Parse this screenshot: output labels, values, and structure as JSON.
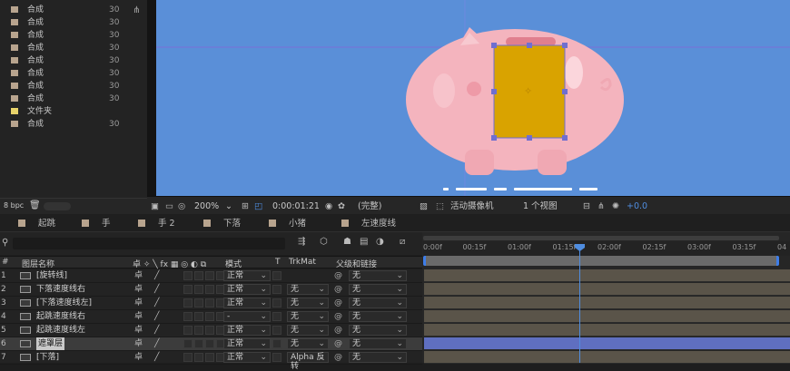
{
  "project": {
    "rows": [
      {
        "name": "合成",
        "duration": "30",
        "color": "#b8a48e"
      },
      {
        "name": "合成",
        "duration": "30",
        "color": "#b8a48e"
      },
      {
        "name": "合成",
        "duration": "30",
        "color": "#b8a48e"
      },
      {
        "name": "合成",
        "duration": "30",
        "color": "#b8a48e"
      },
      {
        "name": "合成",
        "duration": "30",
        "color": "#b8a48e"
      },
      {
        "name": "合成",
        "duration": "30",
        "color": "#b8a48e"
      },
      {
        "name": "合成",
        "duration": "30",
        "color": "#b8a48e"
      },
      {
        "name": "合成",
        "duration": "30",
        "color": "#b8a48e"
      },
      {
        "name": "文件夹",
        "duration": "",
        "color": "#e8d36a"
      },
      {
        "name": "合成",
        "duration": "30",
        "color": "#b8a48e"
      }
    ],
    "bpc": "8 bpc"
  },
  "viewer": {
    "zoom": "200%",
    "timecode": "0:00:01:21",
    "resolution": "(完整)",
    "camera": "活动摄像机",
    "views": "1 个视图",
    "exposure": "+0.0"
  },
  "comp_tabs": [
    "起跳",
    "手",
    "手 2",
    "下落",
    "小猪",
    "左速度线"
  ],
  "timeline": {
    "headers": {
      "name": "图层名称",
      "mode": "模式",
      "t": "T",
      "trkmat": "TrkMat",
      "parent": "父级和链接"
    },
    "ruler_ticks": [
      "0:00f",
      "00:15f",
      "01:00f",
      "01:15f",
      "02:00f",
      "02:15f",
      "03:00f",
      "03:15f",
      "04"
    ],
    "layers": [
      {
        "num": "1",
        "name": "[旋转线]",
        "mode": "正常",
        "trkmat": "",
        "parent": "无"
      },
      {
        "num": "2",
        "name": "下落速度线右",
        "mode": "正常",
        "trkmat": "无",
        "parent": "无"
      },
      {
        "num": "3",
        "name": "[下落速度线左]",
        "mode": "正常",
        "trkmat": "无",
        "parent": "无"
      },
      {
        "num": "4",
        "name": "起跳速度线右",
        "mode": "-",
        "trkmat": "无",
        "parent": "无"
      },
      {
        "num": "5",
        "name": "起跳速度线左",
        "mode": "正常",
        "trkmat": "无",
        "parent": "无"
      },
      {
        "num": "6",
        "name": "遮罩层",
        "mode": "正常",
        "trkmat": "无",
        "parent": "无"
      },
      {
        "num": "7",
        "name": "[下落]",
        "mode": "正常",
        "trkmat": "Alpha 反转",
        "parent": "无"
      }
    ]
  },
  "colors": {
    "comp_bg": "#5a8fd8",
    "accent": "#4f8de0",
    "mask": "#d9a300"
  }
}
